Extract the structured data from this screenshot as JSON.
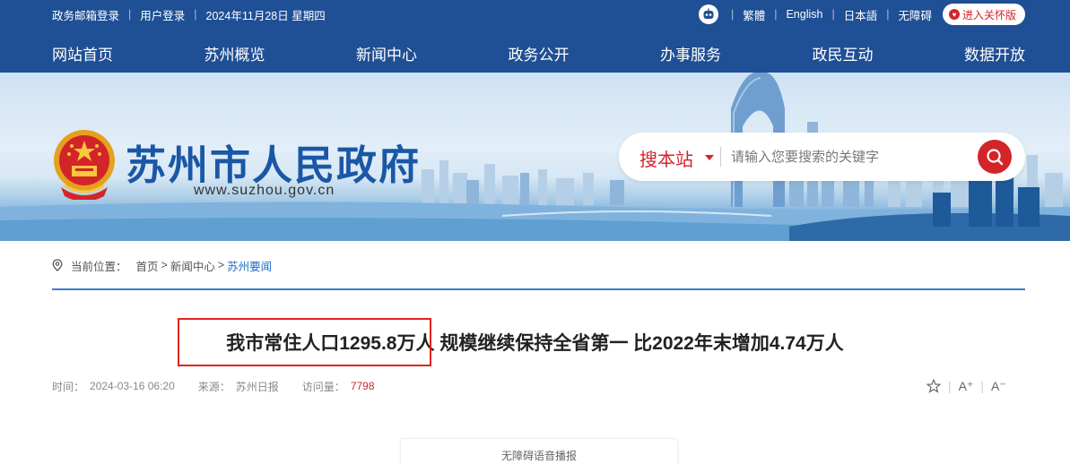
{
  "topbar": {
    "left_links": [
      "政务邮箱登录",
      "用户登录"
    ],
    "date": "2024年11月28日 星期四",
    "right_links": [
      "繁體",
      "English",
      "日本語",
      "无障碍"
    ],
    "care_button": "进入关怀版",
    "colors": {
      "background": "#1f4f95",
      "accent": "#d3242a"
    },
    "icons": [
      "robot-icon",
      "heart-icon"
    ]
  },
  "nav": {
    "items": [
      "网站首页",
      "苏州概览",
      "新闻中心",
      "政务公开",
      "办事服务",
      "政民互动",
      "数据开放"
    ]
  },
  "banner": {
    "site_name": "苏州市人民政府",
    "url": "www.suzhou.gov.cn",
    "search": {
      "scope": "搜本站",
      "placeholder": "请输入您要搜索的关键字"
    },
    "icons": [
      "national-emblem-icon",
      "search-icon",
      "chevron-down-icon"
    ]
  },
  "breadcrumb": {
    "label": "当前位置：",
    "items": [
      "首页",
      "新闻中心",
      "苏州要闻"
    ],
    "icon": "location-pin-icon"
  },
  "article": {
    "title": "我市常住人口1295.8万人 规模继续保持全省第一 比2022年末增加4.74万人",
    "highlighted_text": "我市常住人口1295.8万人",
    "meta": {
      "time_label": "时间：",
      "time": "2024-03-16 06:20",
      "source_label": "来源：",
      "source": "苏州日报",
      "views_label": "访问量：",
      "views": "7798"
    },
    "tools": {
      "bigger": "A⁺",
      "smaller": "A⁻",
      "icons": [
        "star-icon"
      ]
    },
    "audio_label": "无障碍语音播报"
  }
}
